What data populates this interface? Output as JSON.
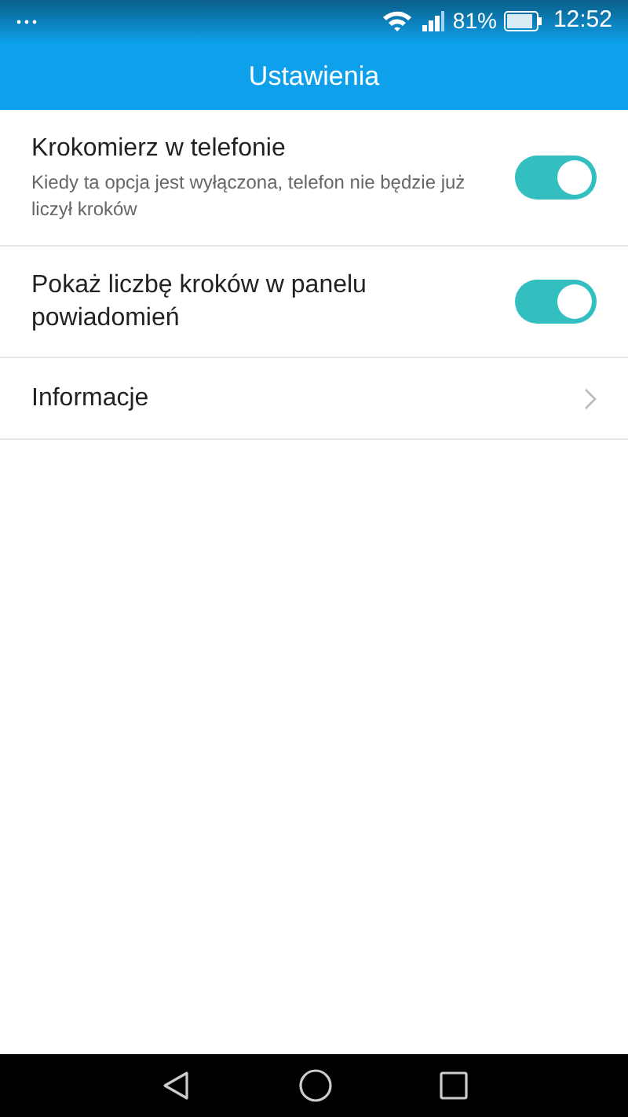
{
  "status_bar": {
    "battery": "81%",
    "time": "12:52"
  },
  "header": {
    "title": "Ustawienia"
  },
  "settings": [
    {
      "kind": "toggle",
      "label": "Krokomierz w telefonie",
      "description": "Kiedy ta opcja jest wyłączona, telefon nie będzie już liczył kroków",
      "on": true
    },
    {
      "kind": "toggle",
      "label": "Pokaż liczbę kroków w panelu powiadomień",
      "on": true
    },
    {
      "kind": "link",
      "label": "Informacje"
    }
  ]
}
